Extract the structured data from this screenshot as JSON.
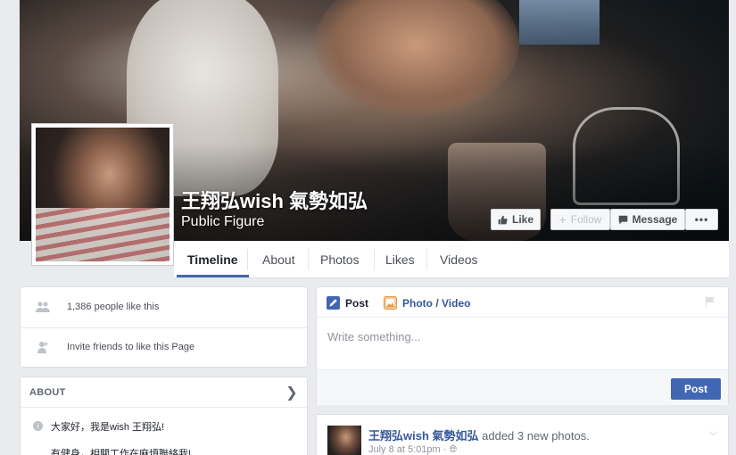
{
  "page": {
    "name": "王翔弘wish 氣勢如弘",
    "category": "Public Figure"
  },
  "actions": {
    "like": "Like",
    "follow": "Follow",
    "message": "Message",
    "more": "•••"
  },
  "tabs": [
    {
      "label": "Timeline",
      "active": true
    },
    {
      "label": "About"
    },
    {
      "label": "Photos"
    },
    {
      "label": "Likes"
    },
    {
      "label": "Videos"
    }
  ],
  "sidebar": {
    "likes_count": "1,386 people like this",
    "invite": "Invite friends to like this Page"
  },
  "about": {
    "header": "ABOUT",
    "line1": "大家好，我是wish 王翔弘!",
    "line2": "有健身，相關工作在麻煩聯絡我!"
  },
  "composer": {
    "tab_post": "Post",
    "tab_photo": "Photo / Video",
    "placeholder": "Write something...",
    "post_button": "Post"
  },
  "feed": {
    "author": "王翔弘wish 氣勢如弘",
    "action": "added 3 new photos.",
    "time": "July 8 at 5:01pm · "
  },
  "colors": {
    "brand": "#4267b2",
    "link": "#365899",
    "background": "#e9ebee"
  }
}
